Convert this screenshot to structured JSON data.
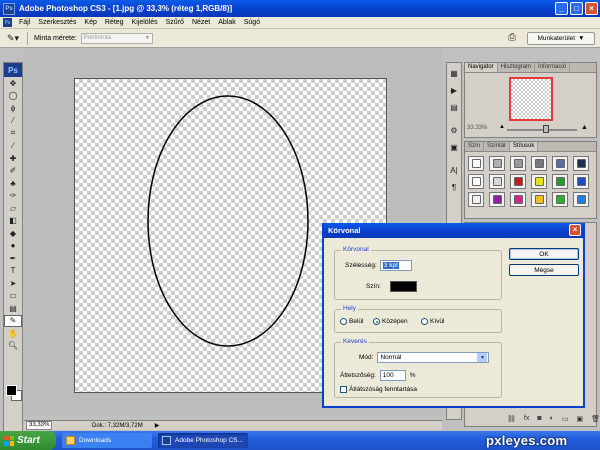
{
  "window": {
    "title": "Adobe Photoshop CS3 - [1.jpg @ 33,3% (réteg 1,RGB/8)]",
    "app_icon": "Ps",
    "buttons": [
      "_",
      "□",
      "×"
    ]
  },
  "menu": {
    "items": [
      "Fájl",
      "Szerkesztés",
      "Kép",
      "Réteg",
      "Kijelölés",
      "Szűrő",
      "Nézet",
      "Ablak",
      "Súgó"
    ]
  },
  "options": {
    "sample_label": "Minta mérete:",
    "sample_value": "Pontminta",
    "workspace_label": "Munkaterület"
  },
  "toolbox": {
    "logo": "Ps",
    "icons": [
      "move-icon",
      "marquee-icon",
      "lasso-icon",
      "magic-wand-icon",
      "crop-icon",
      "slice-icon",
      "healing-icon",
      "brush-icon",
      "stamp-icon",
      "history-brush-icon",
      "eraser-icon",
      "gradient-icon",
      "blur-icon",
      "dodge-icon",
      "pen-icon",
      "type-icon",
      "path-select-icon",
      "shape-icon",
      "notes-icon",
      "eyedropper-icon",
      "hand-icon",
      "zoom-icon"
    ]
  },
  "status": {
    "zoom": "33,33%",
    "doc": "Dok.: 7,32M/3,72M"
  },
  "navigator": {
    "tabs": [
      "Navigátor",
      "Hisztogram",
      "Információ"
    ],
    "zoom": "33.33%"
  },
  "styles_panel": {
    "tabs": [
      "Szín",
      "Színtár",
      "Stílusok"
    ],
    "chips": [
      "#ffffff",
      "#b0b0b0",
      "#9a9a9a",
      "#7a7a7a",
      "#5a6fa0",
      "#1b2f55",
      "#ffffff",
      "#d8d8d8",
      "#c02020",
      "#e8e020",
      "#20a020",
      "#2050c0",
      "#f0f0f0",
      "#9020a0",
      "#e02080",
      "#f0c020",
      "#30b030",
      "#2080e0"
    ]
  },
  "dialog": {
    "title": "Körvonal",
    "stroke_group": "Körvonal",
    "width_label": "Szélesség:",
    "width_value": "3 kpt",
    "color_label": "Szín:",
    "stroke_color": "#000000",
    "location_group": "Hely",
    "location_options": [
      "Belül",
      "Középen",
      "Kívül"
    ],
    "blend_group": "Keverés",
    "mode_label": "Mód:",
    "mode_value": "Normál",
    "opacity_label": "Áttetszőség:",
    "opacity_value": "100",
    "opacity_unit": "%",
    "preserve_label": "Átlátszóság fenntartása",
    "ok_label": "OK",
    "cancel_label": "Mégse"
  },
  "taskbar": {
    "start_label": "Start",
    "items": [
      "Downloads",
      "Adobe Photoshop CS..."
    ],
    "watermark": "pxleyes.com"
  }
}
